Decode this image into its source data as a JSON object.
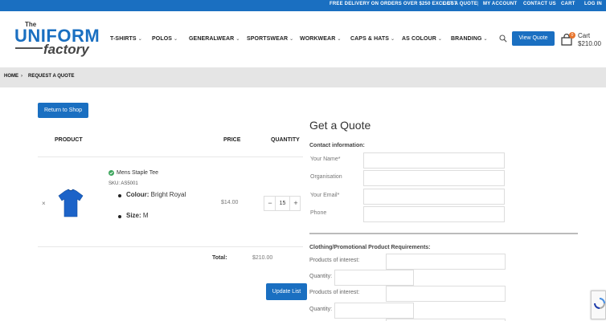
{
  "topbar": {
    "promo": "FREE DELIVERY ON ORDERS OVER $250 EXCL GST",
    "get_quote": "GET A QUOTE",
    "separator": "|",
    "my_account": "MY ACCOUNT",
    "contact": "CONTACT US",
    "cart": "CART",
    "login": "LOG IN"
  },
  "logo": {
    "the": "The",
    "uniform": "UNIFORM",
    "factory": "factory"
  },
  "nav": {
    "items": [
      {
        "label": "T-SHIRTS"
      },
      {
        "label": "POLOS"
      },
      {
        "label": "GENERALWEAR"
      },
      {
        "label": "SPORTSWEAR"
      },
      {
        "label": "WORKWEAR"
      },
      {
        "label": "CAPS & HATS"
      },
      {
        "label": "AS COLOUR"
      },
      {
        "label": "BRANDING"
      }
    ],
    "chevron": "⌄"
  },
  "header": {
    "view_quote": "View Quote",
    "cart_count": "0",
    "cart_label": "Cart",
    "cart_total": "$210.00"
  },
  "breadcrumb": {
    "home": "HOME",
    "separator": "›",
    "current": "REQUEST A QUOTE"
  },
  "cart": {
    "return_label": "Return to Shop",
    "headers": {
      "product": "PRODUCT",
      "price": "PRICE",
      "quantity": "QUANTITY"
    },
    "item": {
      "remove": "×",
      "name": "Mens Staple Tee",
      "sku": "SKU: AS5001",
      "colour_label": "Colour:",
      "colour_value": "Bright Royal",
      "size_label": "Size:",
      "size_value": "M",
      "price": "$14.00",
      "quantity": "15",
      "minus": "−",
      "plus": "+"
    },
    "total_label": "Total:",
    "total_value": "$210.00",
    "update_label": "Update List"
  },
  "quote_form": {
    "title": "Get a Quote",
    "contact_heading": "Contact information:",
    "name_label": "Your Name*",
    "org_label": "Organisation",
    "email_label": "Your Email*",
    "phone_label": "Phone",
    "requirements_heading": "Clothing/Promotional Product Requirements:",
    "products_label": "Products of interest:",
    "quantity_label": "Quantity:"
  },
  "colors": {
    "brand_blue": "#1a6fc1",
    "badge_orange": "#e8742c",
    "breadcrumb_bg": "#e5e5e5"
  }
}
